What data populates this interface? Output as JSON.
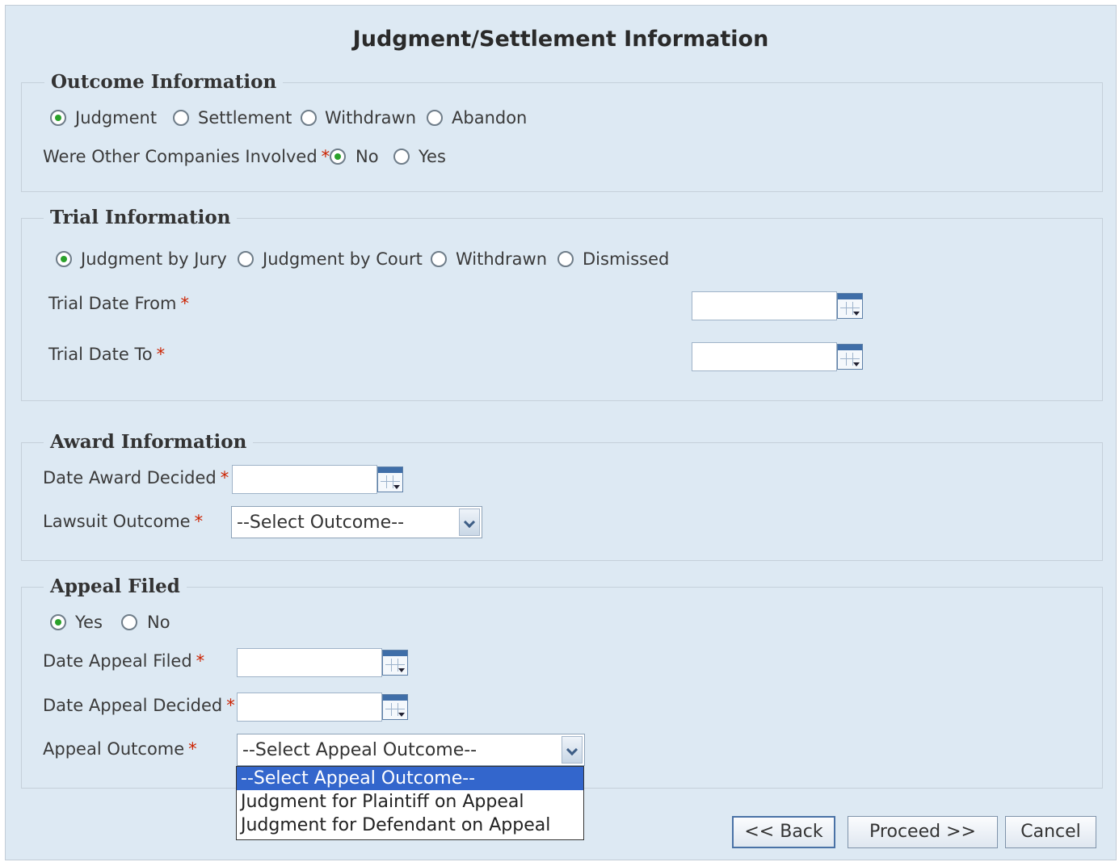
{
  "title": "Judgment/Settlement Information",
  "outcome": {
    "legend": "Outcome Information",
    "options": [
      {
        "label": "Judgment",
        "checked": true
      },
      {
        "label": "Settlement",
        "checked": false
      },
      {
        "label": "Withdrawn",
        "checked": false
      },
      {
        "label": "Abandon",
        "checked": false
      }
    ],
    "other_companies_label": "Were Other Companies Involved",
    "other_companies_options": [
      {
        "label": "No",
        "checked": true
      },
      {
        "label": "Yes",
        "checked": false
      }
    ]
  },
  "trial": {
    "legend": "Trial Information",
    "options": [
      {
        "label": "Judgment by Jury",
        "checked": true
      },
      {
        "label": "Judgment by Court",
        "checked": false
      },
      {
        "label": "Withdrawn",
        "checked": false
      },
      {
        "label": "Dismissed",
        "checked": false
      }
    ],
    "date_from_label": "Trial Date From",
    "date_from_value": "",
    "date_to_label": "Trial Date To",
    "date_to_value": ""
  },
  "award": {
    "legend": "Award Information",
    "date_decided_label": "Date Award Decided",
    "date_decided_value": "",
    "outcome_label": "Lawsuit Outcome",
    "outcome_value": "--Select Outcome--"
  },
  "appeal": {
    "legend": "Appeal Filed",
    "options": [
      {
        "label": "Yes",
        "checked": true
      },
      {
        "label": "No",
        "checked": false
      }
    ],
    "date_filed_label": "Date Appeal Filed",
    "date_filed_value": "",
    "date_decided_label": "Date Appeal Decided",
    "date_decided_value": "",
    "outcome_label": "Appeal Outcome",
    "outcome_value": "--Select Appeal Outcome--",
    "outcome_options": [
      "--Select Appeal Outcome--",
      "Judgment for Plaintiff on Appeal",
      "Judgment for Defendant on Appeal"
    ],
    "outcome_selected_index": 0
  },
  "required_marker": "*",
  "buttons": {
    "back": "<< Back",
    "proceed": "Proceed >>",
    "cancel": "Cancel"
  },
  "icons": {
    "calendar": "calendar-icon",
    "dropdown": "chevron-down-icon",
    "radio": "radio-button"
  },
  "colors": {
    "panel_bg": "#dde9f3",
    "required": "#cc2200",
    "radio_checked": "#2aa12a",
    "dropdown_highlight": "#3366cc"
  }
}
